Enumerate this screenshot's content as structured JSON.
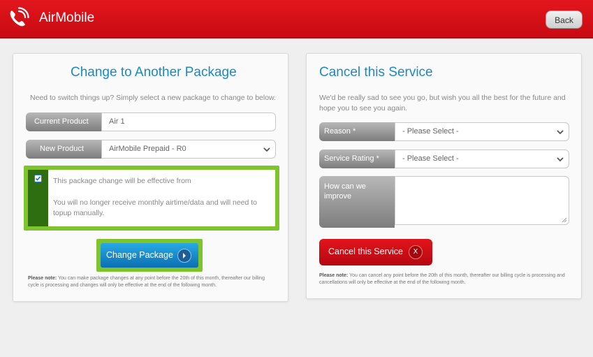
{
  "header": {
    "app_title": "AirMobile",
    "back_label": "Back",
    "logo_icon": "phone-icon",
    "brand_color": "#d3101a"
  },
  "change_panel": {
    "title": "Change to Another Package",
    "description": "Need to switch things up? Simply select a new package to change to below.",
    "current_product": {
      "label": "Current Product",
      "value": "Air 1"
    },
    "new_product": {
      "label": "New Product",
      "value": "AirMobile Prepaid - R0"
    },
    "notice": {
      "checked": true,
      "line1": "This package change will be effective from",
      "line2": "You will no longer receive monthly airtime/data and will need to topup manually."
    },
    "change_button": "Change Package",
    "note_bold": "Please note:",
    "note_text": "You can make package changes at any point before the 20th of this month, thereafter our billing cycle is processing and changes will only be effective at the end of the following month.",
    "accent_color": "#1a8ac3",
    "highlight_color": "#7fc42c"
  },
  "cancel_panel": {
    "title": "Cancel this Service",
    "description": "We'd be really sad to see you go, but wish you all the best for the future and hope you to see you again.",
    "reason": {
      "label": "Reason *",
      "value": "- Please Select -"
    },
    "rating": {
      "label": "Service Rating *",
      "value": "- Please Select -"
    },
    "improve": {
      "label": "How can we improve",
      "value": ""
    },
    "cancel_button": "Cancel this Service",
    "cancel_icon_text": "X",
    "note_bold": "Please note:",
    "note_text": "You can cancel any point before the 20th of this month, thereafter our billing cycle is processing and cancellations will only be effective at the end of the following month."
  }
}
